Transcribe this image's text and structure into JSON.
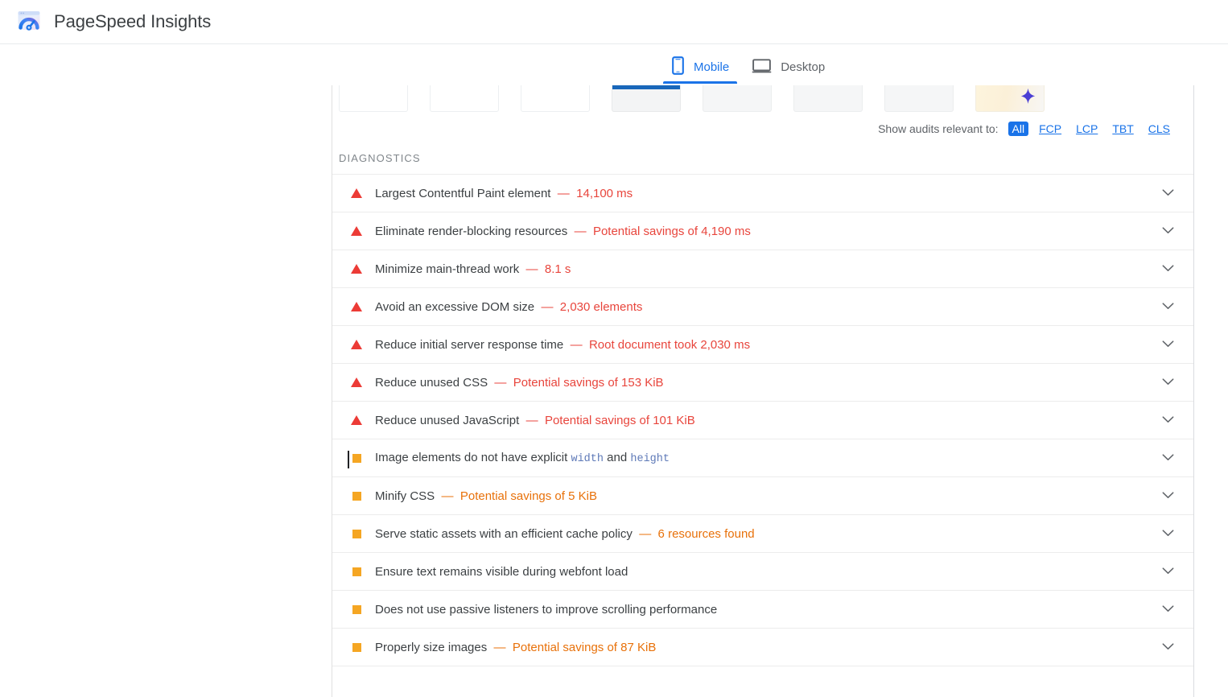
{
  "header": {
    "title": "PageSpeed Insights",
    "logo_icon": "pagespeed-gauge-icon"
  },
  "device_tabs": [
    {
      "label": "Mobile",
      "icon": "mobile-phone-icon",
      "active": true
    },
    {
      "label": "Desktop",
      "icon": "desktop-monitor-icon",
      "active": false
    }
  ],
  "metric_chips": [
    {
      "style": "plain"
    },
    {
      "style": "plain"
    },
    {
      "style": "plain"
    },
    {
      "style": "selected"
    },
    {
      "style": "shaded"
    },
    {
      "style": "shaded"
    },
    {
      "style": "shaded"
    },
    {
      "style": "ai",
      "icon": "sparkle-icon"
    }
  ],
  "filters": {
    "label": "Show audits relevant to:",
    "options": [
      {
        "label": "All",
        "active": true
      },
      {
        "label": "FCP",
        "active": false
      },
      {
        "label": "LCP",
        "active": false
      },
      {
        "label": "TBT",
        "active": false
      },
      {
        "label": "CLS",
        "active": false
      }
    ]
  },
  "section": {
    "title": "DIAGNOSTICS"
  },
  "audits": [
    {
      "score": "fail",
      "title": "Largest Contentful Paint element",
      "separator": "  —  ",
      "value": "14,100 ms"
    },
    {
      "score": "fail",
      "title": "Eliminate render-blocking resources",
      "separator": "  —  ",
      "value": "Potential savings of 4,190 ms"
    },
    {
      "score": "fail",
      "title": "Minimize main-thread work",
      "separator": "  —  ",
      "value": "8.1 s"
    },
    {
      "score": "fail",
      "title": "Avoid an excessive DOM size",
      "separator": "  —  ",
      "value": "2,030 elements"
    },
    {
      "score": "fail",
      "title": "Reduce initial server response time",
      "separator": "  —  ",
      "value": "Root document took 2,030 ms"
    },
    {
      "score": "fail",
      "title": "Reduce unused CSS",
      "separator": "  —  ",
      "value": "Potential savings of 153 KiB"
    },
    {
      "score": "fail",
      "title": "Reduce unused JavaScript",
      "separator": "  —  ",
      "value": "Potential savings of 101 KiB"
    },
    {
      "score": "avg",
      "caret": true,
      "title": "Image elements do not have explicit ",
      "code1": "width",
      "mid": " and ",
      "code2": "height",
      "separator": "",
      "value": ""
    },
    {
      "score": "avg",
      "title": "Minify CSS",
      "separator": "  —  ",
      "value": "Potential savings of 5 KiB"
    },
    {
      "score": "avg",
      "title": "Serve static assets with an efficient cache policy",
      "separator": "  —  ",
      "value": "6 resources found"
    },
    {
      "score": "avg",
      "title": "Ensure text remains visible during webfont load",
      "separator": "",
      "value": ""
    },
    {
      "score": "avg",
      "title": "Does not use passive listeners to improve scrolling performance",
      "separator": "",
      "value": ""
    },
    {
      "score": "avg",
      "title": "Properly size images",
      "separator": "  —  ",
      "value": "Potential savings of 87 KiB"
    }
  ],
  "colors": {
    "accent_blue": "#1a73e8",
    "fail_red": "#e8453c",
    "average_orange": "#e8710a",
    "score_orange": "#f5a623",
    "text_primary": "#3c4043",
    "text_secondary": "#5f6368"
  },
  "icons": {
    "chevron": "chevron-down-icon"
  }
}
